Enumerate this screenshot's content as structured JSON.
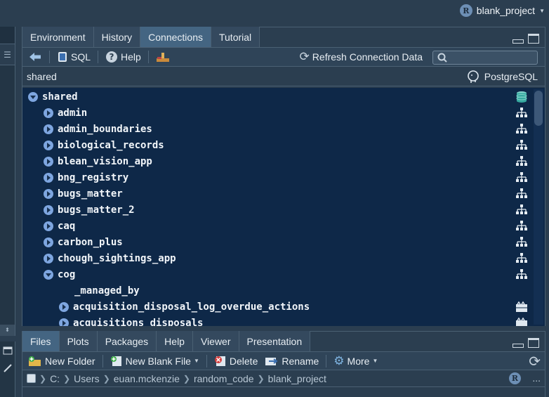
{
  "project": {
    "name": "blank_project",
    "badge": "R"
  },
  "top_pane": {
    "tabs": [
      {
        "label": "Environment",
        "active": false
      },
      {
        "label": "History",
        "active": false
      },
      {
        "label": "Connections",
        "active": true
      },
      {
        "label": "Tutorial",
        "active": false
      }
    ],
    "toolbar": {
      "sql_label": "SQL",
      "help_label": "Help",
      "refresh_label": "Refresh Connection Data",
      "search_placeholder": ""
    },
    "connection": {
      "name": "shared",
      "driver": "PostgreSQL"
    },
    "tree": {
      "root": "shared",
      "schemas": [
        "admin",
        "admin_boundaries",
        "biological_records",
        "blean_vision_app",
        "bng_registry",
        "bugs_matter",
        "bugs_matter_2",
        "caq",
        "carbon_plus",
        "chough_sightings_app",
        "cog"
      ],
      "expanded_schema": "cog",
      "cog_items": [
        "_managed_by",
        "acquisition_disposal_log_overdue_actions",
        "acquisitions_disposals"
      ]
    }
  },
  "bottom_pane": {
    "tabs": [
      {
        "label": "Files",
        "active": true
      },
      {
        "label": "Plots",
        "active": false
      },
      {
        "label": "Packages",
        "active": false
      },
      {
        "label": "Help",
        "active": false
      },
      {
        "label": "Viewer",
        "active": false
      },
      {
        "label": "Presentation",
        "active": false
      }
    ],
    "toolbar": {
      "new_folder": "New Folder",
      "new_blank_file": "New Blank File",
      "delete": "Delete",
      "rename": "Rename",
      "more": "More"
    },
    "path": [
      "C:",
      "Users",
      "euan.mckenzie",
      "random_code",
      "blank_project"
    ],
    "ellipsis": "..."
  },
  "colors": {
    "background": "#2b3e50",
    "tree_background": "#0e2848",
    "active_tab": "#446582",
    "expander": "#7ea6e0"
  }
}
